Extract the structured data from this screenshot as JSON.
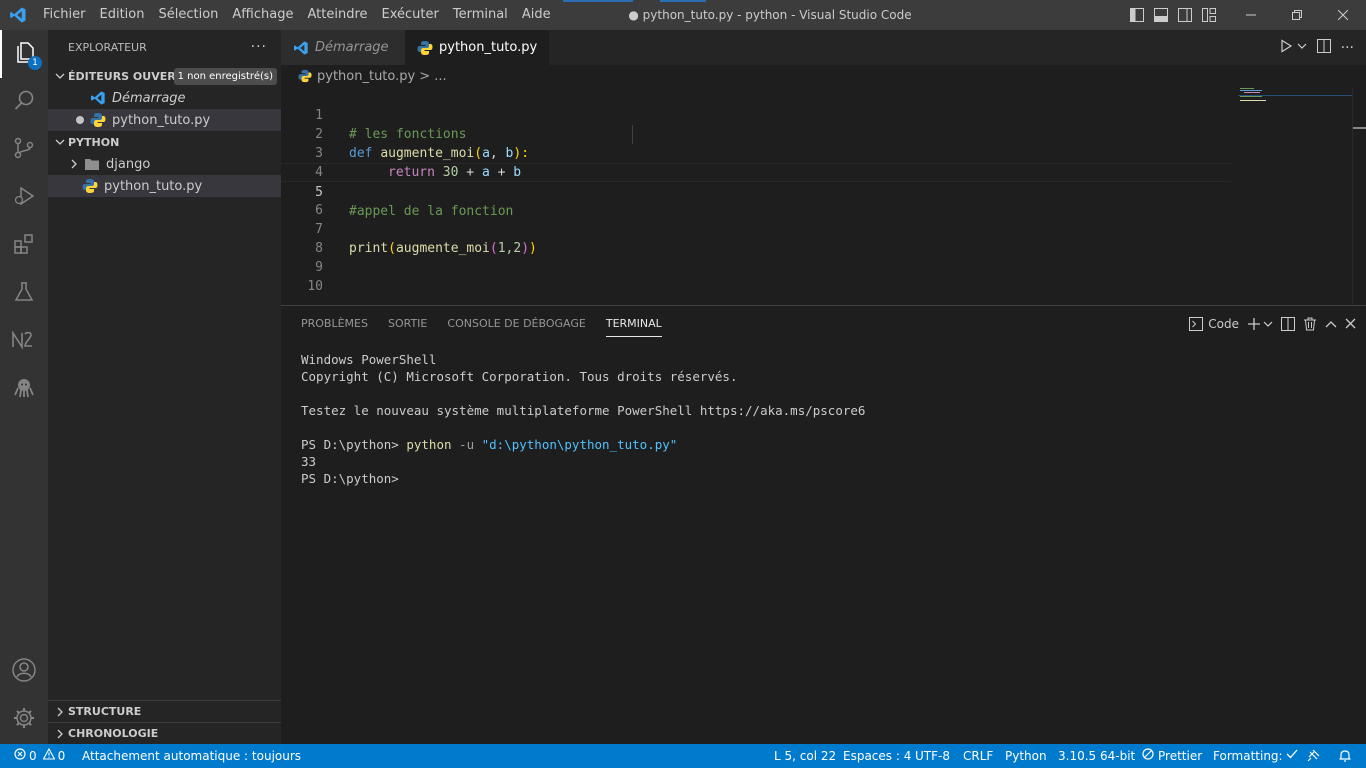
{
  "titlebar": {
    "menu": [
      "Fichier",
      "Edition",
      "Sélection",
      "Affichage",
      "Atteindre",
      "Exécuter",
      "Terminal",
      "Aide"
    ],
    "window_title": "● python_tuto.py - python - Visual Studio Code"
  },
  "activity": {
    "explorer_badge": "1"
  },
  "sidebar": {
    "title": "EXPLORATEUR",
    "more": "···",
    "open_editors": {
      "label": "ÉDITEURS OUVERTS",
      "badge": "1 non enregistré(s)",
      "items": [
        {
          "label": "Démarrage"
        },
        {
          "label": "python_tuto.py"
        }
      ]
    },
    "folder": {
      "label": "PYTHON",
      "items": [
        {
          "label": "django"
        },
        {
          "label": "python_tuto.py"
        }
      ]
    },
    "outline": "STRUCTURE",
    "timeline": "CHRONOLOGIE"
  },
  "tabs": [
    {
      "label": "Démarrage"
    },
    {
      "label": "python_tuto.py"
    }
  ],
  "breadcrumb": {
    "file": "python_tuto.py",
    "sep": "> ..."
  },
  "editor": {
    "line_numbers": [
      "1",
      "2",
      "3",
      "4",
      "5",
      "6",
      "7",
      "8",
      "9",
      "10"
    ],
    "line1": "# les fonctions",
    "line2": {
      "kw": "def",
      "fn": "augmente_moi",
      "p1": "a",
      "p2": "b",
      "open": "(",
      "comma": ", ",
      "close": "):"
    },
    "line3": {
      "kw": "return",
      "num": "30",
      "rest1": " + ",
      "a": "a",
      "rest2": " + ",
      "b": "b"
    },
    "line5": "#appel de la fonction",
    "line7": {
      "fn1": "print",
      "fn2": "augmente_moi",
      "args": "1,2"
    }
  },
  "panel": {
    "tabs": [
      "PROBLÈMES",
      "SORTIE",
      "CONSOLE DE DÉBOGAGE",
      "TERMINAL"
    ],
    "terminal_name": "Code",
    "terminal_lines": [
      "Windows PowerShell",
      "Copyright (C) Microsoft Corporation. Tous droits réservés.",
      "",
      "Testez le nouveau système multiplateforme PowerShell https://aka.ms/pscore6",
      ""
    ],
    "prompt": "PS D:\\python> ",
    "cmd": "python",
    "opt": " -u ",
    "arg": "\"d:\\python\\python_tuto.py\"",
    "output": "33",
    "prompt2": "PS D:\\python>"
  },
  "statusbar": {
    "errors": "0",
    "warnings": "0",
    "auto_attach": "Attachement automatique : toujours",
    "position": "L 5, col 22",
    "spaces": "Espaces : 4",
    "encoding": "UTF-8",
    "eol": "CRLF",
    "language": "Python",
    "interpreter": "3.10.5 64-bit",
    "prettier": "Prettier",
    "formatting": "Formatting:"
  },
  "colors": {
    "accent": "#007acc",
    "titlebar": "#3c3c3c",
    "activitybar": "#333333",
    "sidebar": "#252526",
    "editor": "#1e1e1e"
  }
}
